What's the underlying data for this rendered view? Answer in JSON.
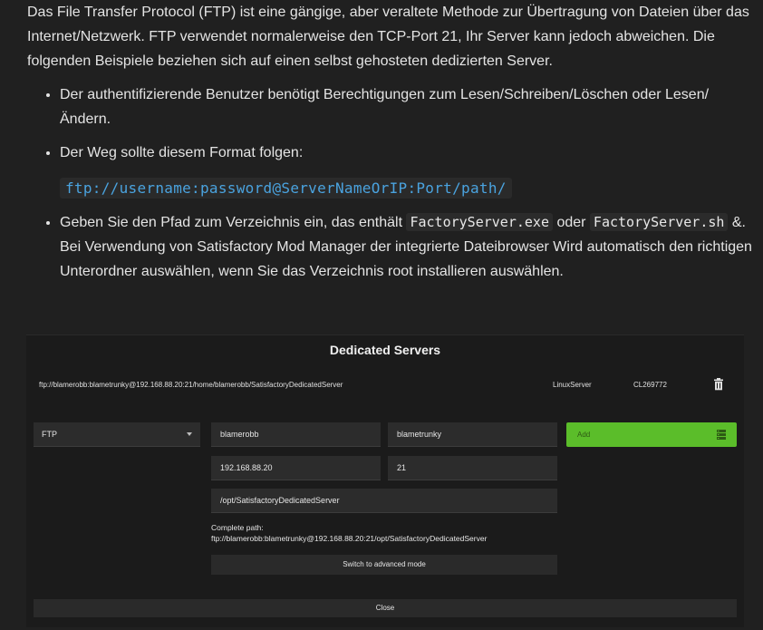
{
  "doc": {
    "intro": "Das File Transfer Protocol (FTP) ist eine gängige, aber veraltete Methode zur Übertragung von Dateien über das Internet/Netzwerk. FTP verwendet normalerweise den TCP-Port 21, Ihr Server kann jedoch abweichen. Die folgenden Beispiele beziehen sich auf einen selbst gehosteten dedizierten Server.",
    "bullet1": "Der authentifizierende Benutzer benötigt Berechtigungen zum Lesen/Schreiben/Löschen oder Lesen/Ändern.",
    "bullet2": "Der Weg sollte diesem Format folgen:",
    "code_example": "ftp://username:password@ServerNameOrIP:Port/path/",
    "bullet3_a": "Geben Sie den Pfad zum Verzeichnis ein, das enthält ",
    "code_exe": "FactoryServer.exe",
    "bullet3_b": " oder ",
    "code_sh": "FactoryServer.sh",
    "bullet3_c": " &. Bei Verwendung von Satisfactory Mod Manager der integrierte Dateibrowser Wird automatisch den richtigen Unterordner auswählen, wenn Sie das Verzeichnis root installieren auswählen."
  },
  "dialog": {
    "title": "Dedicated Servers",
    "server": {
      "path": "ftp://blamerobb:blametrunky@192.168.88.20:21/home/blamerobb/SatisfactoryDedicatedServer",
      "type": "LinuxServer",
      "version": "CL269772",
      "delete_icon": "trash-icon"
    },
    "protocol": "FTP",
    "username": "blamerobb",
    "password": "blametrunky",
    "host": "192.168.88.20",
    "port": "21",
    "path": "/opt/SatisfactoryDedicatedServer",
    "add_label": "Add",
    "add_icon": "server-list-icon",
    "complete_label": "Complete path:",
    "complete_value": "ftp://blamerobb:blametrunky@192.168.88.20:21/opt/SatisfactoryDedicatedServer",
    "advanced_label": "Switch to advanced mode",
    "close_label": "Close",
    "accent_color": "#5bbd2a"
  }
}
